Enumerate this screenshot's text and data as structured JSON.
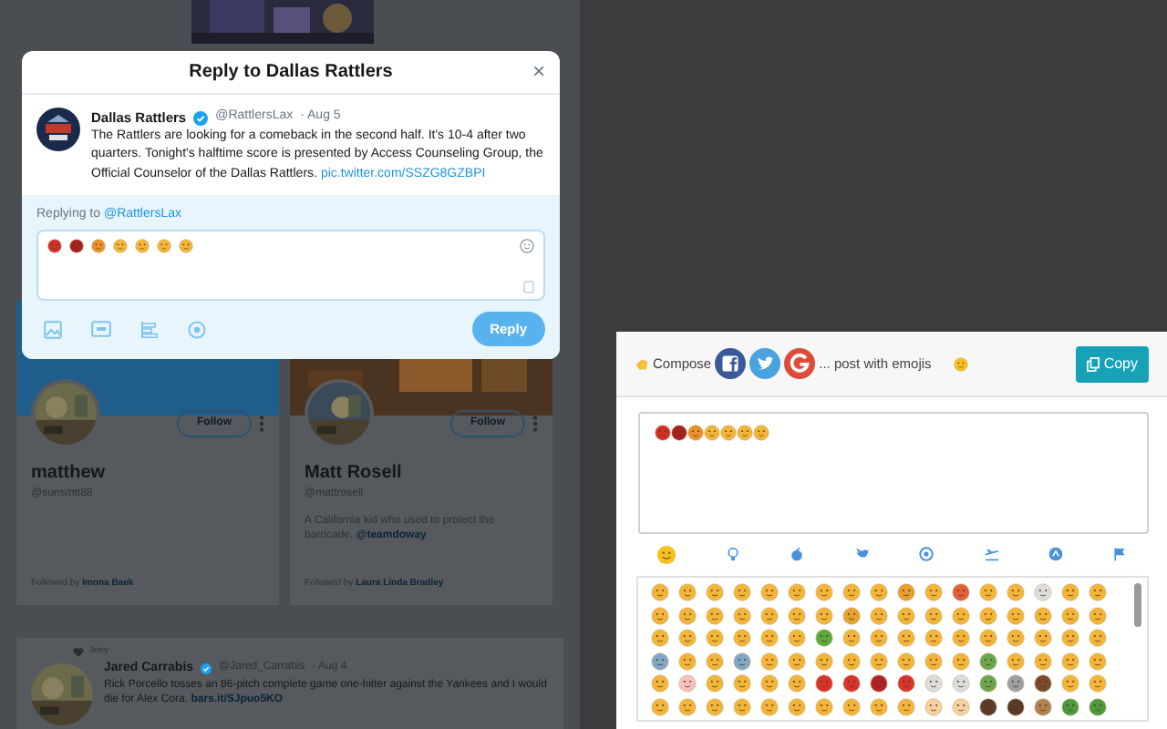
{
  "background_page": {
    "follow_cards": [
      {
        "name": "matthew",
        "handle": "@sunsmtt88",
        "follow_button": "Follow",
        "followed_by_prefix": "Followed by",
        "followed_by": "Imona Baek"
      },
      {
        "name": "Matt Rosell",
        "handle": "@mattrosell",
        "bio": "A California kid who used to protect the barricade.",
        "bio_link": "@teamdoway",
        "follow_button": "Follow",
        "followed_by_prefix": "Followed by",
        "followed_by": "Laura Linda Bradley"
      }
    ],
    "tweet": {
      "context": "Joey",
      "name": "Jared Carrabis",
      "verified": true,
      "handle": "@Jared_Carrabis",
      "date": "· Aug 4",
      "text": "Rick Porcello tosses an 86-pitch complete game one-hitter against the Yankees and I would die for Alex Cora.",
      "link": "bars.it/SJpuo5KO"
    }
  },
  "reply_dialog": {
    "title": "Reply to Dallas Rattlers",
    "close": "×",
    "tweet": {
      "name": "Dallas Rattlers",
      "verified": true,
      "handle": "@RattlersLax",
      "date": "· Aug 5",
      "text": "The Rattlers are looking for a comeback in the second half. It's 10-4 after two quarters. Tonight's halftime score is presented by Access Counseling Group, the Official Counselor of the Dallas Rattlers.",
      "link": "pic.twitter.com/SSZG8GZBPI"
    },
    "replying_prefix": "Replying to",
    "replying_to": "@RattlersLax",
    "reply_emojis": [
      {
        "color": "#d0302a"
      },
      {
        "color": "#a82020"
      },
      {
        "color": "#e8902c"
      },
      {
        "color": "#f2b53a"
      },
      {
        "color": "#f2b53a"
      },
      {
        "color": "#f2b53a"
      },
      {
        "color": "#f2b53a"
      }
    ],
    "reply_button": "Reply"
  },
  "emoji_panel": {
    "compose_label": "Compose",
    "tagline": "... post with emojis",
    "copy_button": "Copy",
    "text_emojis": [
      {
        "color": "#d0302a"
      },
      {
        "color": "#a82020"
      },
      {
        "color": "#e8902c"
      },
      {
        "color": "#f2b53a"
      },
      {
        "color": "#f2b53a"
      },
      {
        "color": "#f2b53a"
      },
      {
        "color": "#f2b53a"
      }
    ],
    "categories": [
      {
        "selected": true
      },
      {
        "selected": false
      },
      {
        "selected": false
      },
      {
        "selected": false
      },
      {
        "selected": false
      },
      {
        "selected": false
      },
      {
        "selected": false
      },
      {
        "selected": false
      }
    ],
    "emoji_grid": [
      [
        {
          "color": "#f2b53a"
        },
        {
          "color": "#f2b53a"
        },
        {
          "color": "#f2b53a"
        },
        {
          "color": "#f2b53a"
        },
        {
          "color": "#f2b53a"
        },
        {
          "color": "#f2b53a"
        },
        {
          "color": "#f2b53a"
        },
        {
          "color": "#f2b53a"
        },
        {
          "color": "#f2b53a"
        },
        {
          "color": "#e8a030"
        },
        {
          "color": "#f2b53a"
        },
        {
          "color": "#e2603a"
        },
        {
          "color": "#f2b53a"
        },
        {
          "color": "#f2b53a"
        },
        {
          "color": "#dddddd"
        },
        {
          "color": "#f2b53a"
        },
        {
          "color": "#f2b53a"
        }
      ],
      [
        {
          "color": "#f2b53a"
        },
        {
          "color": "#f2b53a"
        },
        {
          "color": "#f2b53a"
        },
        {
          "color": "#f2b53a"
        },
        {
          "color": "#f2b53a"
        },
        {
          "color": "#f2b53a"
        },
        {
          "color": "#f2b53a"
        },
        {
          "color": "#e8a030"
        },
        {
          "color": "#f2b53a"
        },
        {
          "color": "#f2b53a"
        },
        {
          "color": "#f2b53a"
        },
        {
          "color": "#f2b53a"
        },
        {
          "color": "#f2b53a"
        },
        {
          "color": "#f2b53a"
        },
        {
          "color": "#f2b53a"
        },
        {
          "color": "#f2b53a"
        },
        {
          "color": "#f2b53a"
        }
      ],
      [
        {
          "color": "#f2b53a"
        },
        {
          "color": "#f2b53a"
        },
        {
          "color": "#f2b53a"
        },
        {
          "color": "#f2b53a"
        },
        {
          "color": "#f2b53a"
        },
        {
          "color": "#f2b53a"
        },
        {
          "color": "#5bab3c"
        },
        {
          "color": "#f2b53a"
        },
        {
          "color": "#f2b53a"
        },
        {
          "color": "#f2b53a"
        },
        {
          "color": "#f2b53a"
        },
        {
          "color": "#f2b53a"
        },
        {
          "color": "#f2b53a"
        },
        {
          "color": "#f2b53a"
        },
        {
          "color": "#f2b53a"
        },
        {
          "color": "#f2b53a"
        },
        {
          "color": "#f2b53a"
        }
      ],
      [
        {
          "color": "#7fa8c8"
        },
        {
          "color": "#f2b53a"
        },
        {
          "color": "#f2b53a"
        },
        {
          "color": "#7fa8c8"
        },
        {
          "color": "#f2b53a"
        },
        {
          "color": "#f2b53a"
        },
        {
          "color": "#f2b53a"
        },
        {
          "color": "#f2b53a"
        },
        {
          "color": "#f2b53a"
        },
        {
          "color": "#f2b53a"
        },
        {
          "color": "#f2b53a"
        },
        {
          "color": "#f2b53a"
        },
        {
          "color": "#6aa84f"
        },
        {
          "color": "#f2b53a"
        },
        {
          "color": "#f2b53a"
        },
        {
          "color": "#f2b53a"
        },
        {
          "color": "#f2b53a"
        }
      ],
      [
        {
          "color": "#f2b53a"
        },
        {
          "color": "#f6c0c0"
        },
        {
          "color": "#f2b53a"
        },
        {
          "color": "#f2b53a"
        },
        {
          "color": "#f2b53a"
        },
        {
          "color": "#f2b53a"
        },
        {
          "color": "#d9342b"
        },
        {
          "color": "#d9342b"
        },
        {
          "color": "#b22222"
        },
        {
          "color": "#d9342b"
        },
        {
          "color": "#dcdcdc"
        },
        {
          "color": "#dcdcdc"
        },
        {
          "color": "#6aa84f"
        },
        {
          "color": "#9aa0a6"
        },
        {
          "color": "#7a4a2a"
        },
        {
          "color": "#f2b53a"
        },
        {
          "color": "#f2b53a"
        }
      ],
      [
        {
          "color": "#f2b53a"
        },
        {
          "color": "#f2b53a"
        },
        {
          "color": "#f2b53a"
        },
        {
          "color": "#f2b53a"
        },
        {
          "color": "#f2b53a"
        },
        {
          "color": "#f2b53a"
        },
        {
          "color": "#f2b53a"
        },
        {
          "color": "#f2b53a"
        },
        {
          "color": "#f2b53a"
        },
        {
          "color": "#f2b53a"
        },
        {
          "color": "#f5d0a0"
        },
        {
          "color": "#f5d0a0"
        },
        {
          "color": "#5a3a2a"
        },
        {
          "color": "#5a3a2a"
        },
        {
          "color": "#b08050"
        },
        {
          "color": "#4c9a3c"
        },
        {
          "color": "#4c9a3c"
        }
      ]
    ]
  }
}
